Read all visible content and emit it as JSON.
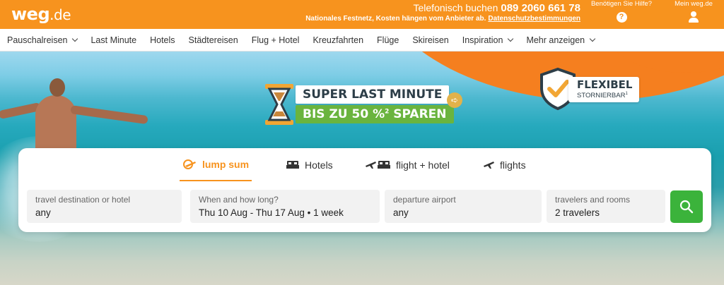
{
  "header": {
    "logo_main": "weg",
    "logo_tld": ".de",
    "phone_label": "Telefonisch buchen",
    "phone_number": "089 2060 661 78",
    "phone_note": "Nationales Festnetz, Kosten hängen vom Anbieter ab.",
    "privacy_link": "Datenschutzbestimmungen",
    "help_label": "Benötigen Sie Hilfe?",
    "help_icon_glyph": "?",
    "account_label": "Mein weg.de",
    "brand_color": "#f7931e"
  },
  "nav": {
    "items": [
      {
        "label": "Pauschalreisen",
        "dropdown": true
      },
      {
        "label": "Last Minute",
        "dropdown": false
      },
      {
        "label": "Hotels",
        "dropdown": false
      },
      {
        "label": "Städtereisen",
        "dropdown": false
      },
      {
        "label": "Flug + Hotel",
        "dropdown": false
      },
      {
        "label": "Kreuzfahrten",
        "dropdown": false
      },
      {
        "label": "Flüge",
        "dropdown": false
      },
      {
        "label": "Skireisen",
        "dropdown": false
      },
      {
        "label": "Inspiration",
        "dropdown": true
      },
      {
        "label": "Mehr anzeigen",
        "dropdown": true
      }
    ]
  },
  "promo": {
    "line1": "SUPER LAST MINUTE",
    "line2_prefix": "BIS ZU 50 %",
    "line2_sup": "2",
    "line2_suffix": " SPAREN",
    "arrow_glyph": "➪",
    "badge_title": "FLEXIBEL",
    "badge_sub": "STORNIERBAR",
    "badge_sup": "1"
  },
  "search": {
    "tabs": [
      {
        "label": "lump sum",
        "icon": "plane-sun-icon",
        "active": true
      },
      {
        "label": "Hotels",
        "icon": "bed-icon",
        "active": false
      },
      {
        "label": "flight + hotel",
        "icon": "plane-bed-icon",
        "active": false
      },
      {
        "label": "flights",
        "icon": "plane-icon",
        "active": false
      }
    ],
    "fields": [
      {
        "label": "travel destination or hotel",
        "value": "any"
      },
      {
        "label": "When and how long?",
        "value": "Thu 10 Aug - Thu 17 Aug • 1 week"
      },
      {
        "label": "departure airport",
        "value": "any"
      },
      {
        "label": "travelers and rooms",
        "value": "2 travelers"
      }
    ],
    "search_button_color": "#3bb33b"
  }
}
